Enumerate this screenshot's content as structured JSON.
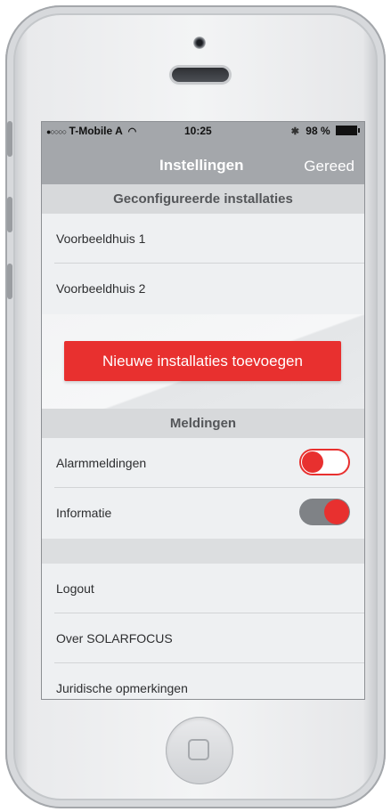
{
  "status_bar": {
    "carrier": "T-Mobile A",
    "signal_dots": "●○○○○",
    "time": "10:25",
    "battery": "98 %",
    "icons": [
      "wifi-icon",
      "bluetooth-icon",
      "battery-icon"
    ]
  },
  "navbar": {
    "title": "Instellingen",
    "done_label": "Gereed"
  },
  "installations": {
    "header": "Geconfigureerde installaties",
    "items": [
      {
        "label": "Voorbeeldhuis 1"
      },
      {
        "label": "Voorbeeldhuis 2"
      }
    ],
    "add_button": "Nieuwe installaties toevoegen"
  },
  "notifications": {
    "header": "Meldingen",
    "items": [
      {
        "label": "Alarmmeldingen",
        "enabled": false
      },
      {
        "label": "Informatie",
        "enabled": true
      }
    ]
  },
  "menu": {
    "items": [
      {
        "label": "Logout"
      },
      {
        "label": "Over SOLARFOCUS"
      },
      {
        "label": "Juridische opmerkingen"
      }
    ]
  },
  "colors": {
    "accent": "#e8302f",
    "navbar": "#a4a7ab",
    "section_header": "#d7d9db",
    "background": "#eef0f2"
  }
}
